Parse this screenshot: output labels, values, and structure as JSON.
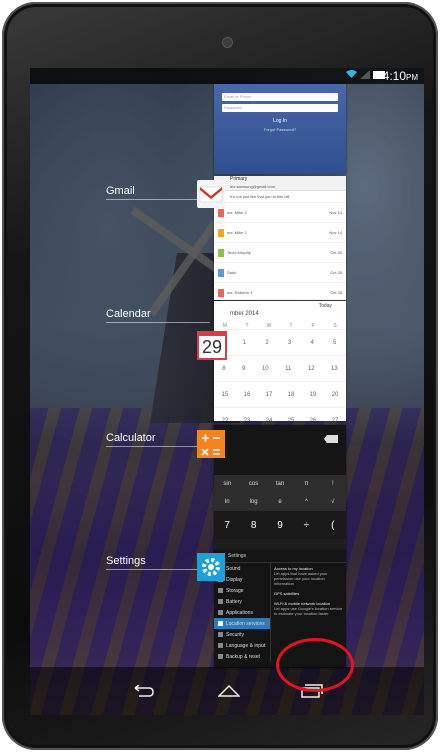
{
  "statusbar": {
    "time": "4:10",
    "ampm": "PM"
  },
  "apps": [
    {
      "label": "Gmail"
    },
    {
      "label": "Calendar"
    },
    {
      "label": "Calculator"
    },
    {
      "label": "Settings"
    }
  ],
  "login_card": {
    "email_placeholder": "Email or Phone",
    "password_placeholder": "Password",
    "login_button": "Log In",
    "forgot": "Forgot Password?"
  },
  "gmail_card": {
    "title": "Primary",
    "account": "leo.samsung@gmail.com",
    "search_hint": "It's not just like that you to this bill",
    "mails": [
      {
        "sender": "me, Mike  2",
        "time": "Nov 14"
      },
      {
        "sender": "me, Mike  2",
        "time": "Nov 14"
      },
      {
        "sender": "Techl Murphy",
        "time": "Oct 30"
      },
      {
        "sender": "Sabri",
        "time": "Oct 28"
      },
      {
        "sender": "me, Roberto  3",
        "time": "Oct 28"
      }
    ]
  },
  "calendar_card": {
    "date_icon": "29",
    "month": "mber 2014",
    "today_label": "Today",
    "days": [
      "M",
      "T",
      "W",
      "T",
      "F",
      "S"
    ],
    "weeks": [
      [
        "",
        "1",
        "2",
        "3",
        "4",
        "5"
      ],
      [
        "8",
        "9",
        "10",
        "11",
        "12",
        "13"
      ],
      [
        "15",
        "16",
        "17",
        "18",
        "19",
        "20"
      ],
      [
        "22",
        "23",
        "24",
        "25",
        "26",
        "27"
      ]
    ]
  },
  "calculator_card": {
    "sci_row1": [
      "sin",
      "cos",
      "tan",
      "π",
      "!"
    ],
    "sci_row2": [
      "ln",
      "log",
      "e",
      "^",
      "√"
    ],
    "num_row": [
      "7",
      "8",
      "9",
      "÷",
      "("
    ]
  },
  "settings_card": {
    "header": "Settings",
    "items": [
      "Sound",
      "Display",
      "Storage",
      "Battery",
      "Applications",
      "Location services",
      "Security",
      "Language & input",
      "Backup & reset"
    ],
    "right_title1": "Access to my location",
    "right_text1": "Let apps that have asked your permission use your location information",
    "right_row2": "GPS satellites",
    "right_title3": "Wi-Fi & mobile network location",
    "right_text3": "Let apps use Google's location service to estimate your location faster."
  },
  "colors": {
    "accent_red": "#e0141e",
    "calc_orange": "#f48320",
    "settings_blue": "#1ea0d9",
    "fb_blue": "#3b5998"
  }
}
